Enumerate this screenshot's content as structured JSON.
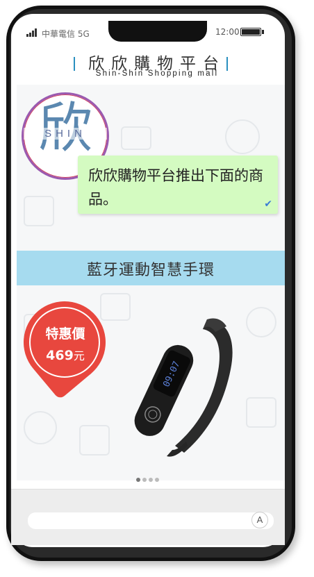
{
  "status_bar": {
    "carrier": "中華電信 5G",
    "time": "12:00"
  },
  "header": {
    "title": "欣欣購物平台",
    "subtitle": "Shin-Shin Shopping mall"
  },
  "logo": {
    "character": "欣",
    "text": "SHIN"
  },
  "message": {
    "text": "欣欣購物平台推出下面的商品。"
  },
  "product": {
    "name": "藍牙運動智慧手環",
    "price_label": "特惠價",
    "price_value": "469",
    "price_unit": "元",
    "watch_display": "09:07"
  },
  "carousel": {
    "total": 4,
    "active_index": 0
  },
  "input_bar": {
    "font_button_label": "A"
  },
  "colors": {
    "banner": "#a6dbef",
    "bubble": "#d4fbc1",
    "price_tag": "#e8473e",
    "accent_bar": "#2a8fbf"
  }
}
